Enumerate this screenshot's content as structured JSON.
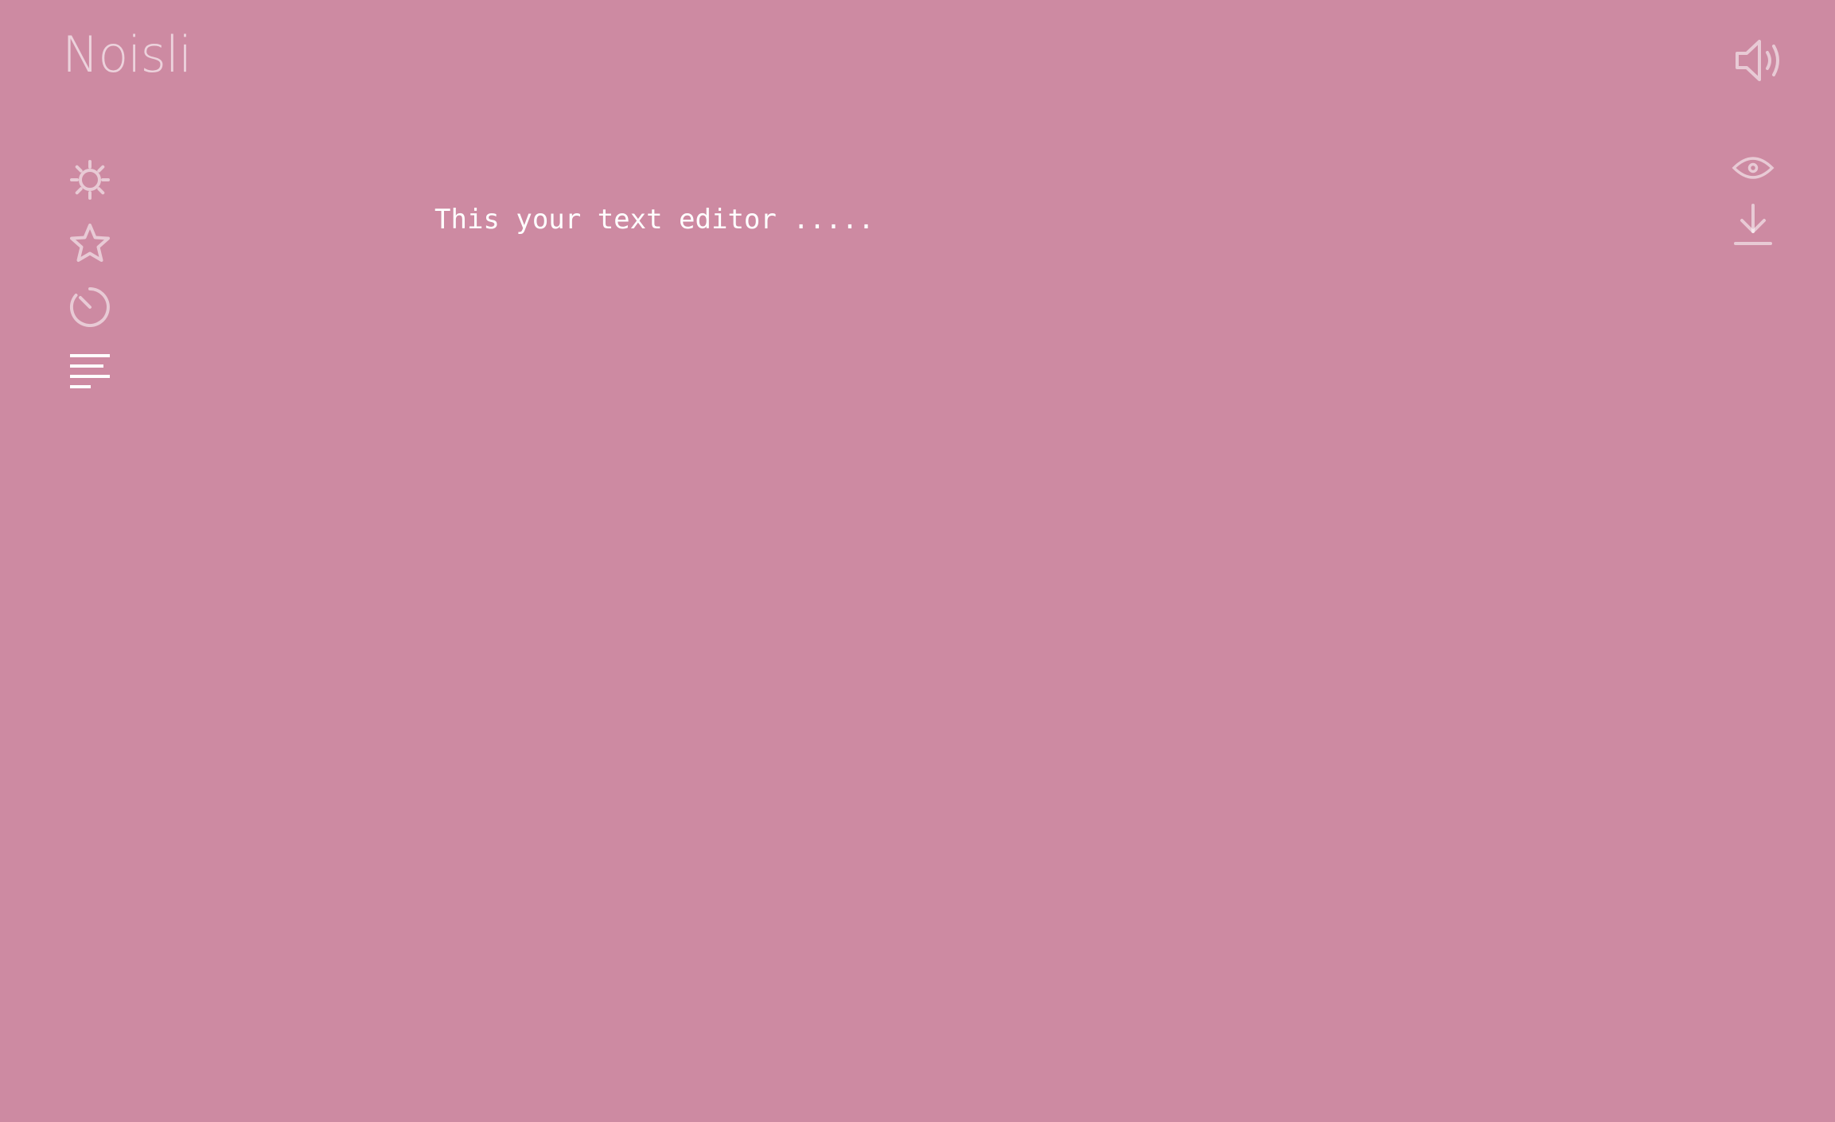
{
  "app": {
    "logo": "Noisli"
  },
  "sidebar": {
    "items": [
      {
        "icon": "gear-icon",
        "active": false
      },
      {
        "icon": "star-icon",
        "active": false
      },
      {
        "icon": "timer-icon",
        "active": false
      },
      {
        "icon": "text-lines-icon",
        "active": true
      }
    ]
  },
  "topbar": {
    "volume_icon": "speaker-volume-icon"
  },
  "editor_tools": {
    "preview_icon": "eye-icon",
    "download_icon": "download-icon"
  },
  "editor": {
    "text": "This your text editor ....."
  },
  "colors": {
    "background": "#cd8aa2",
    "icon_dim": "rgba(255,255,255,0.55)",
    "icon_active": "#ffffff",
    "text": "#ffffff"
  }
}
